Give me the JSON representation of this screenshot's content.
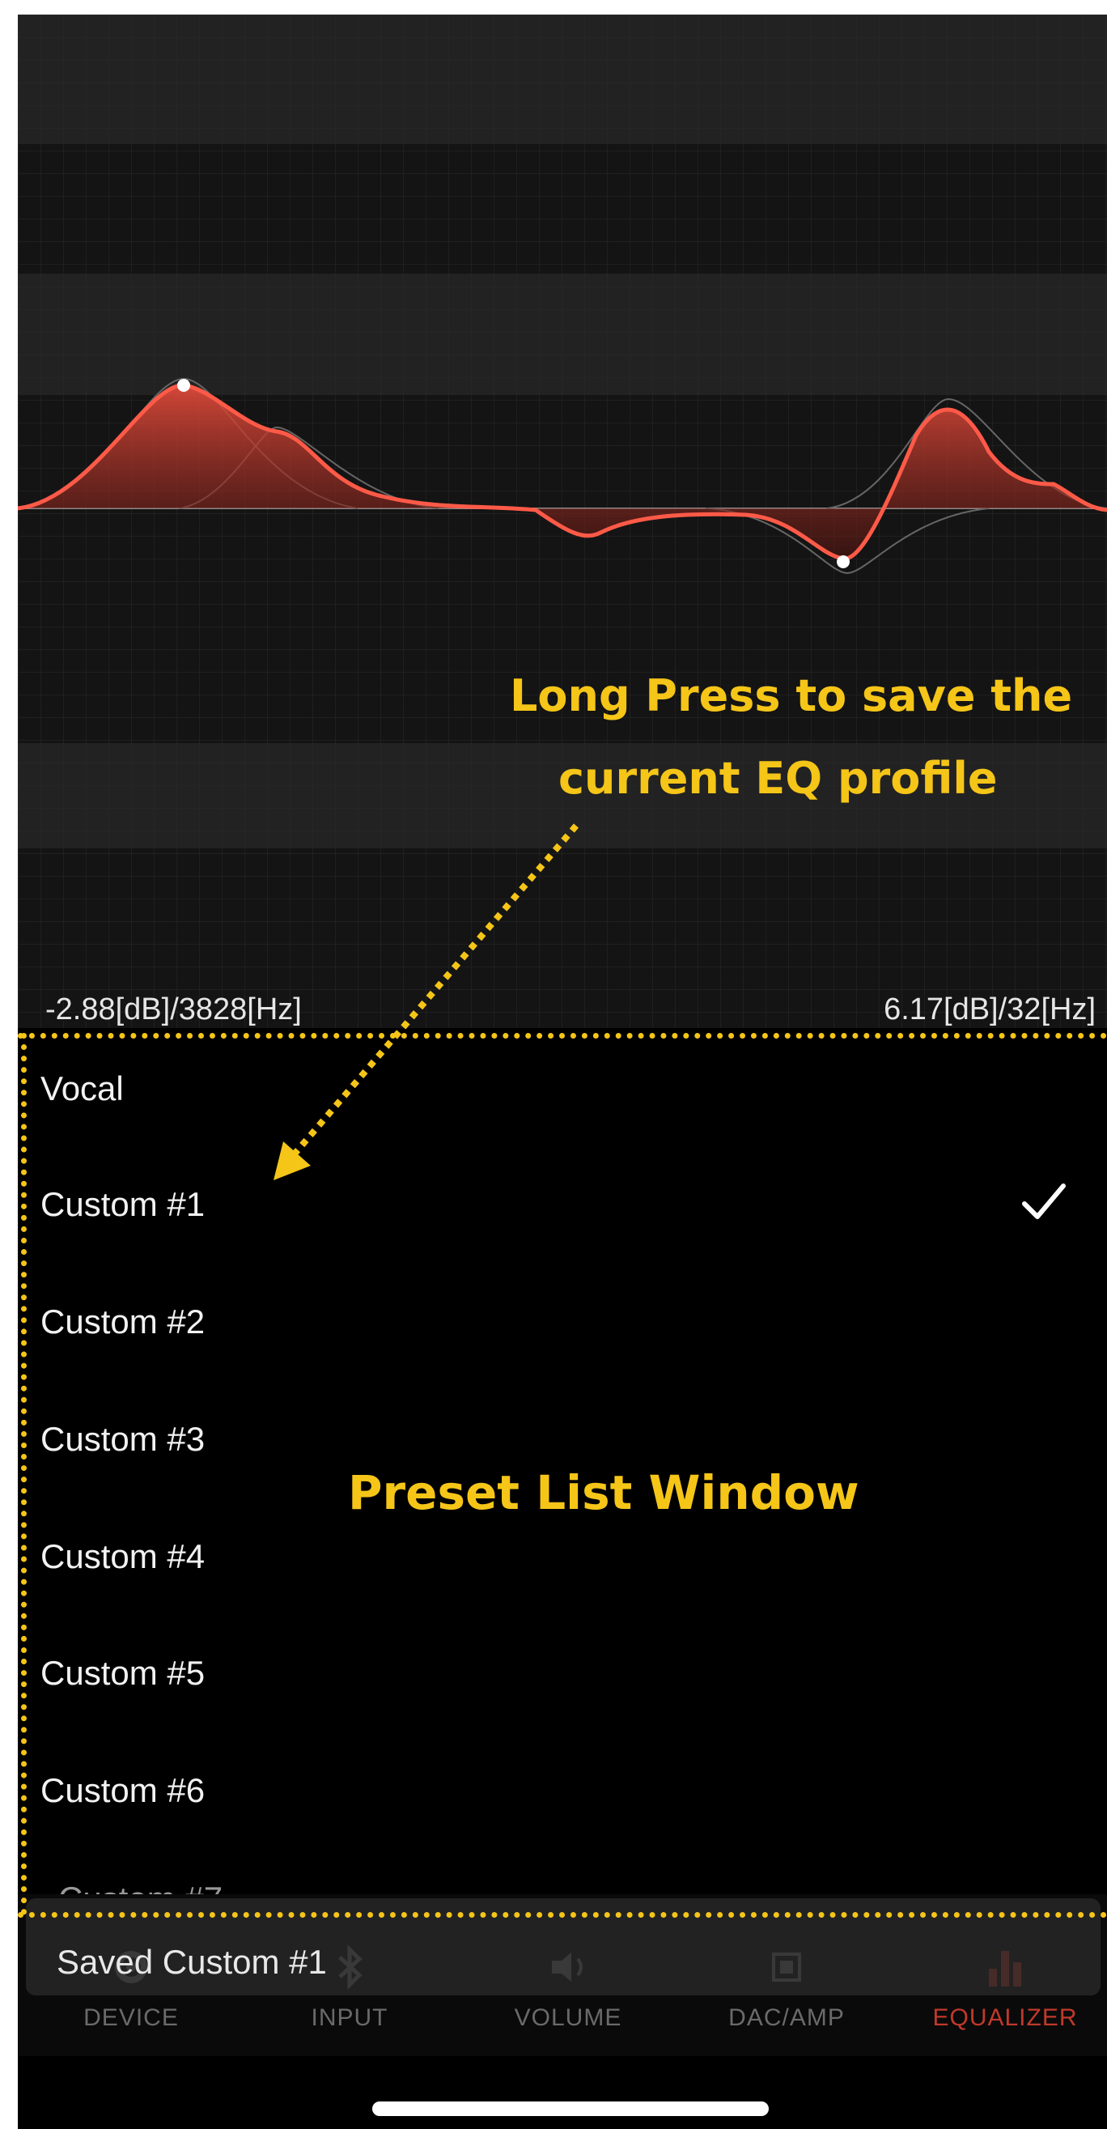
{
  "eq": {
    "readout_left": "-2.88[dB]/3828[Hz]",
    "readout_right": "6.17[dB]/32[Hz]",
    "curve_color": "#e74c3c"
  },
  "annotations": {
    "long_press_line1": "Long Press to save the",
    "long_press_line2": "current EQ profile",
    "preset_window": "Preset List Window",
    "color": "#f5c518"
  },
  "presets": {
    "items": [
      "Vocal",
      "Custom #1",
      "Custom #2",
      "Custom #3",
      "Custom #4",
      "Custom #5",
      "Custom #6"
    ],
    "partially_visible": "Custom #7",
    "selected": "Custom #1"
  },
  "toast": {
    "text": "Saved Custom #1"
  },
  "tab_bar": {
    "tabs": [
      {
        "label": "DEVICE",
        "icon": "gear-icon"
      },
      {
        "label": "INPUT",
        "icon": "bluetooth-icon"
      },
      {
        "label": "VOLUME",
        "icon": "speaker-icon"
      },
      {
        "label": "DAC/AMP",
        "icon": "chip-icon"
      },
      {
        "label": "EQUALIZER",
        "icon": "bar-chart-icon"
      }
    ],
    "active": "EQUALIZER",
    "active_color": "#c0392b"
  }
}
